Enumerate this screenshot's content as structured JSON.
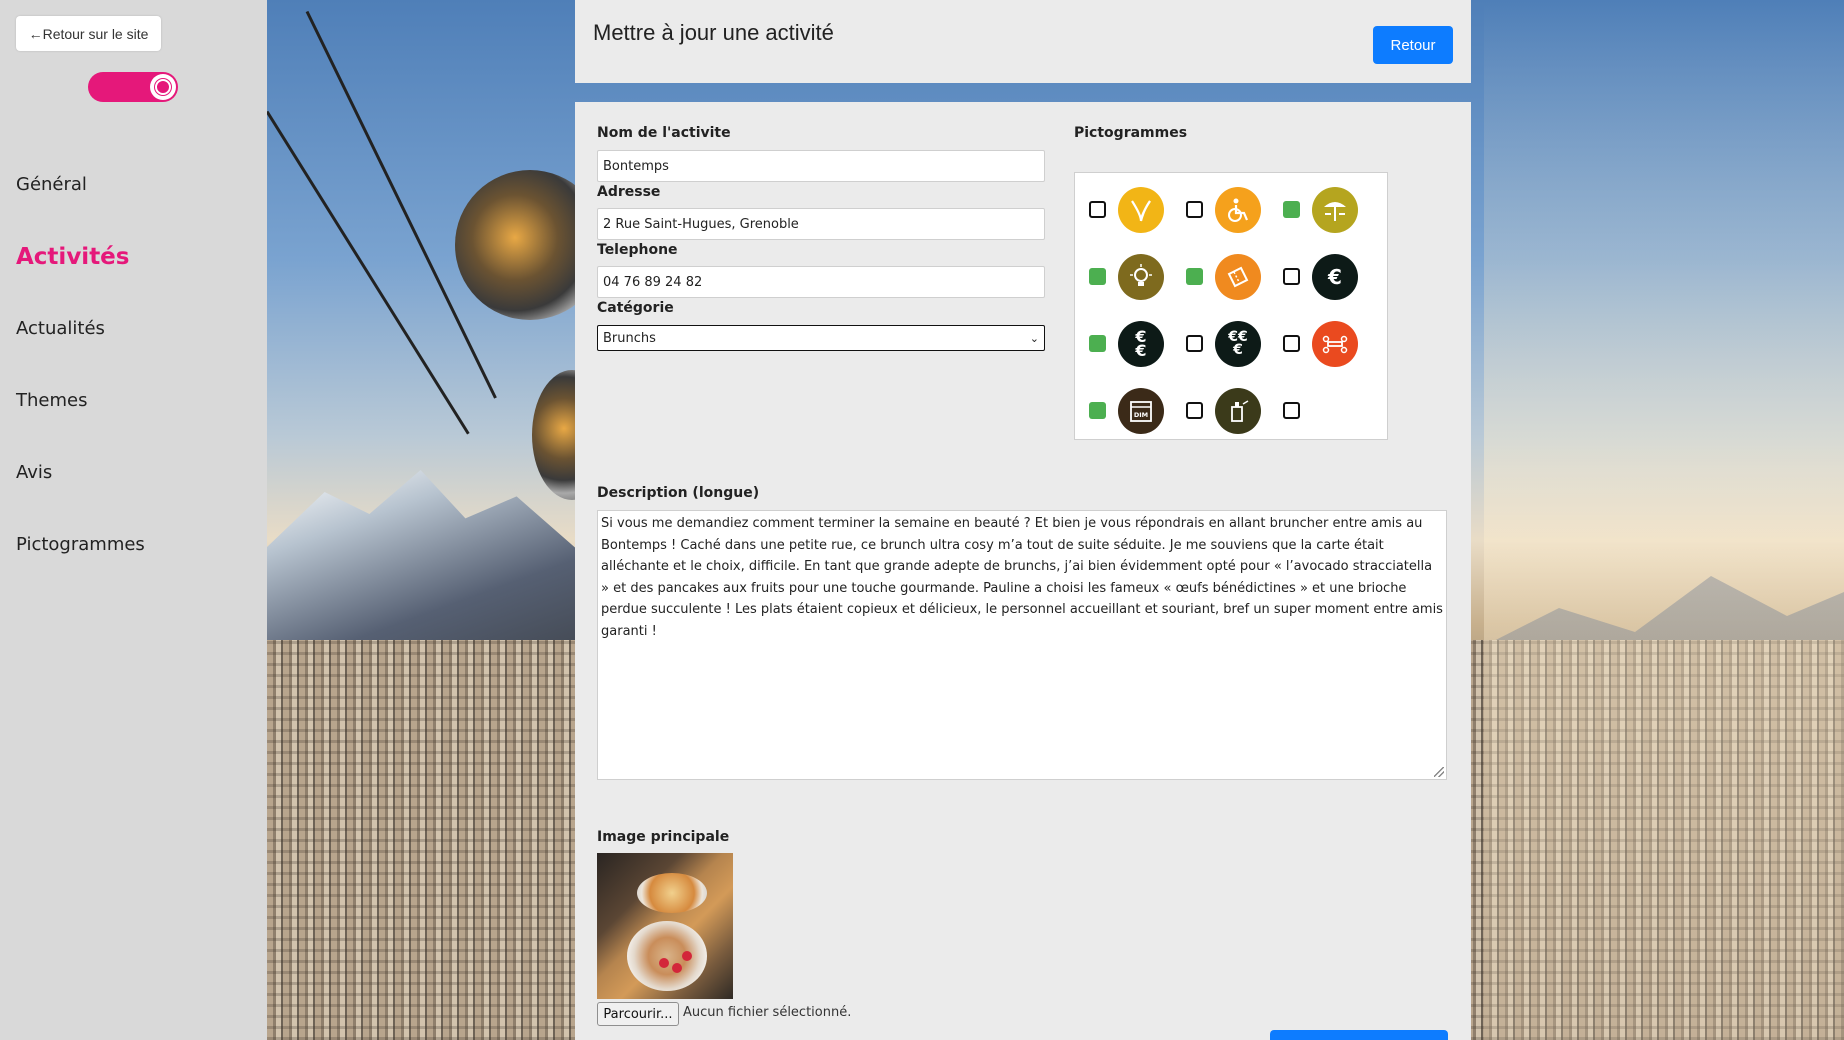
{
  "sidebar": {
    "back_label": "←Retour sur le site",
    "items": [
      {
        "label": "Général",
        "active": false
      },
      {
        "label": "Activités",
        "active": true
      },
      {
        "label": "Actualités",
        "active": false
      },
      {
        "label": "Themes",
        "active": false
      },
      {
        "label": "Avis",
        "active": false
      },
      {
        "label": "Pictogrammes",
        "active": false
      }
    ]
  },
  "header": {
    "title": "Mettre à jour une activité",
    "back_button": "Retour"
  },
  "form": {
    "name_label": "Nom de l'activite",
    "name_value": "Bontemps",
    "address_label": "Adresse",
    "address_value": "2 Rue Saint-Hugues, Grenoble",
    "phone_label": "Telephone",
    "phone_value": "04 76 89 24 82",
    "category_label": "Catégorie",
    "category_value": "Brunchs",
    "pictos_label": "Pictogrammes",
    "description_label": "Description (longue)",
    "description_value": "Si vous me demandiez comment terminer la semaine en beauté ? Et bien je vous répondrais en allant bruncher entre amis au Bontemps ! Caché dans une petite rue, ce brunch ultra cosy m’a tout de suite séduite. Je me souviens que la carte était alléchante et le choix, difficile. En tant que grande adepte de brunchs, j’ai bien évidemment opté pour « l’avocado stracciatella » et des pancakes aux fruits pour une touche gourmande. Pauline a choisi les fameux « œufs bénédictines » et une brioche perdue succulente ! Les plats étaient copieux et délicieux, le personnel accueillant et souriant, bref un super moment entre amis garanti !",
    "image_label": "Image principale",
    "file_button": "Parcourir...",
    "file_status": "Aucun fichier sélectionné."
  },
  "pictograms": [
    {
      "icon": "vegan-leaf-icon",
      "checked": false,
      "color": "#f2b516"
    },
    {
      "icon": "wheelchair-icon",
      "checked": false,
      "color": "#f5a11c"
    },
    {
      "icon": "terrace-umbrella-icon",
      "checked": true,
      "color": "#b5a51f"
    },
    {
      "icon": "lightbulb-icon",
      "checked": true,
      "color": "#7e6a1e"
    },
    {
      "icon": "ticket-icon",
      "checked": true,
      "color": "#f08a1f"
    },
    {
      "icon": "euro-icon",
      "checked": false,
      "color": "#0d1a17"
    },
    {
      "icon": "two-euro-icon",
      "checked": true,
      "color": "#0d1a17"
    },
    {
      "icon": "three-euro-icon",
      "checked": false,
      "color": "#0d1a17"
    },
    {
      "icon": "group-table-icon",
      "checked": false,
      "color": "#ea4a1f"
    },
    {
      "icon": "sunday-calendar-icon",
      "checked": true,
      "color": "#3b2a18"
    },
    {
      "icon": "drink-bottle-icon",
      "checked": false,
      "color": "#3b3a1a"
    },
    {
      "icon": "",
      "checked": false,
      "color": ""
    }
  ],
  "colors": {
    "accent": "#e5187a",
    "primary_button": "#0d7cff",
    "checked": "#4caf50"
  }
}
